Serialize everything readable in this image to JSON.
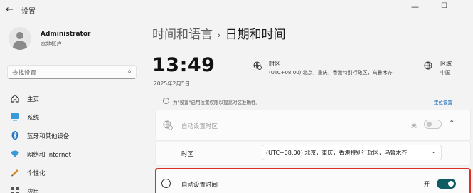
{
  "window": {
    "title": "设置",
    "back_icon": "back-arrow-icon"
  },
  "user": {
    "name": "Administrator",
    "account_type": "本地帐户"
  },
  "search": {
    "placeholder": "查找设置"
  },
  "sidebar": {
    "items": [
      {
        "label": "主页",
        "icon": "home-icon"
      },
      {
        "label": "系统",
        "icon": "system-icon"
      },
      {
        "label": "蓝牙和其他设备",
        "icon": "bluetooth-icon"
      },
      {
        "label": "网络和 Internet",
        "icon": "network-icon"
      },
      {
        "label": "个性化",
        "icon": "personalization-icon"
      },
      {
        "label": "应用",
        "icon": "apps-icon"
      }
    ]
  },
  "breadcrumb": {
    "parent": "时间和语言",
    "separator": "›",
    "current": "日期和时间"
  },
  "clock": {
    "time": "13:49",
    "date": "2025年2月5日"
  },
  "timezone_summary": {
    "title": "时区",
    "value": "(UTC+08:00) 北京，重庆，香港特别行政区，乌鲁木齐"
  },
  "region_summary": {
    "title": "区域",
    "value": "中国"
  },
  "notice": {
    "text": "为\"设置\"启用位置权限以提高时区准确性。",
    "link": "定位设置"
  },
  "auto_timezone": {
    "label": "自动设置时区",
    "state_label": "关",
    "enabled": false
  },
  "timezone_row": {
    "label": "时区",
    "selected": "(UTC+08:00) 北京，重庆，香港特别行政区，乌鲁木齐"
  },
  "auto_time": {
    "label": "自动设置时间",
    "state_label": "开",
    "enabled": true
  },
  "colors": {
    "accent": "#0f5c63",
    "highlight_border": "#d93025",
    "link": "#005fb8"
  }
}
